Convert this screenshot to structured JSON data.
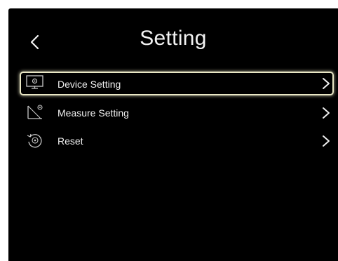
{
  "header": {
    "title": "Setting",
    "back_icon": "chevron-left-icon"
  },
  "menu": {
    "items": [
      {
        "label": "Device Setting",
        "icon": "monitor-icon",
        "selected": true
      },
      {
        "label": "Measure Setting",
        "icon": "measure-angle-icon",
        "selected": false
      },
      {
        "label": "Reset",
        "icon": "reset-icon",
        "selected": false
      }
    ],
    "chevron_icon": "chevron-right-icon"
  },
  "colors": {
    "screen_background": "#000000",
    "text": "#f0f0f0",
    "selection_border": "#e9e7c5"
  }
}
